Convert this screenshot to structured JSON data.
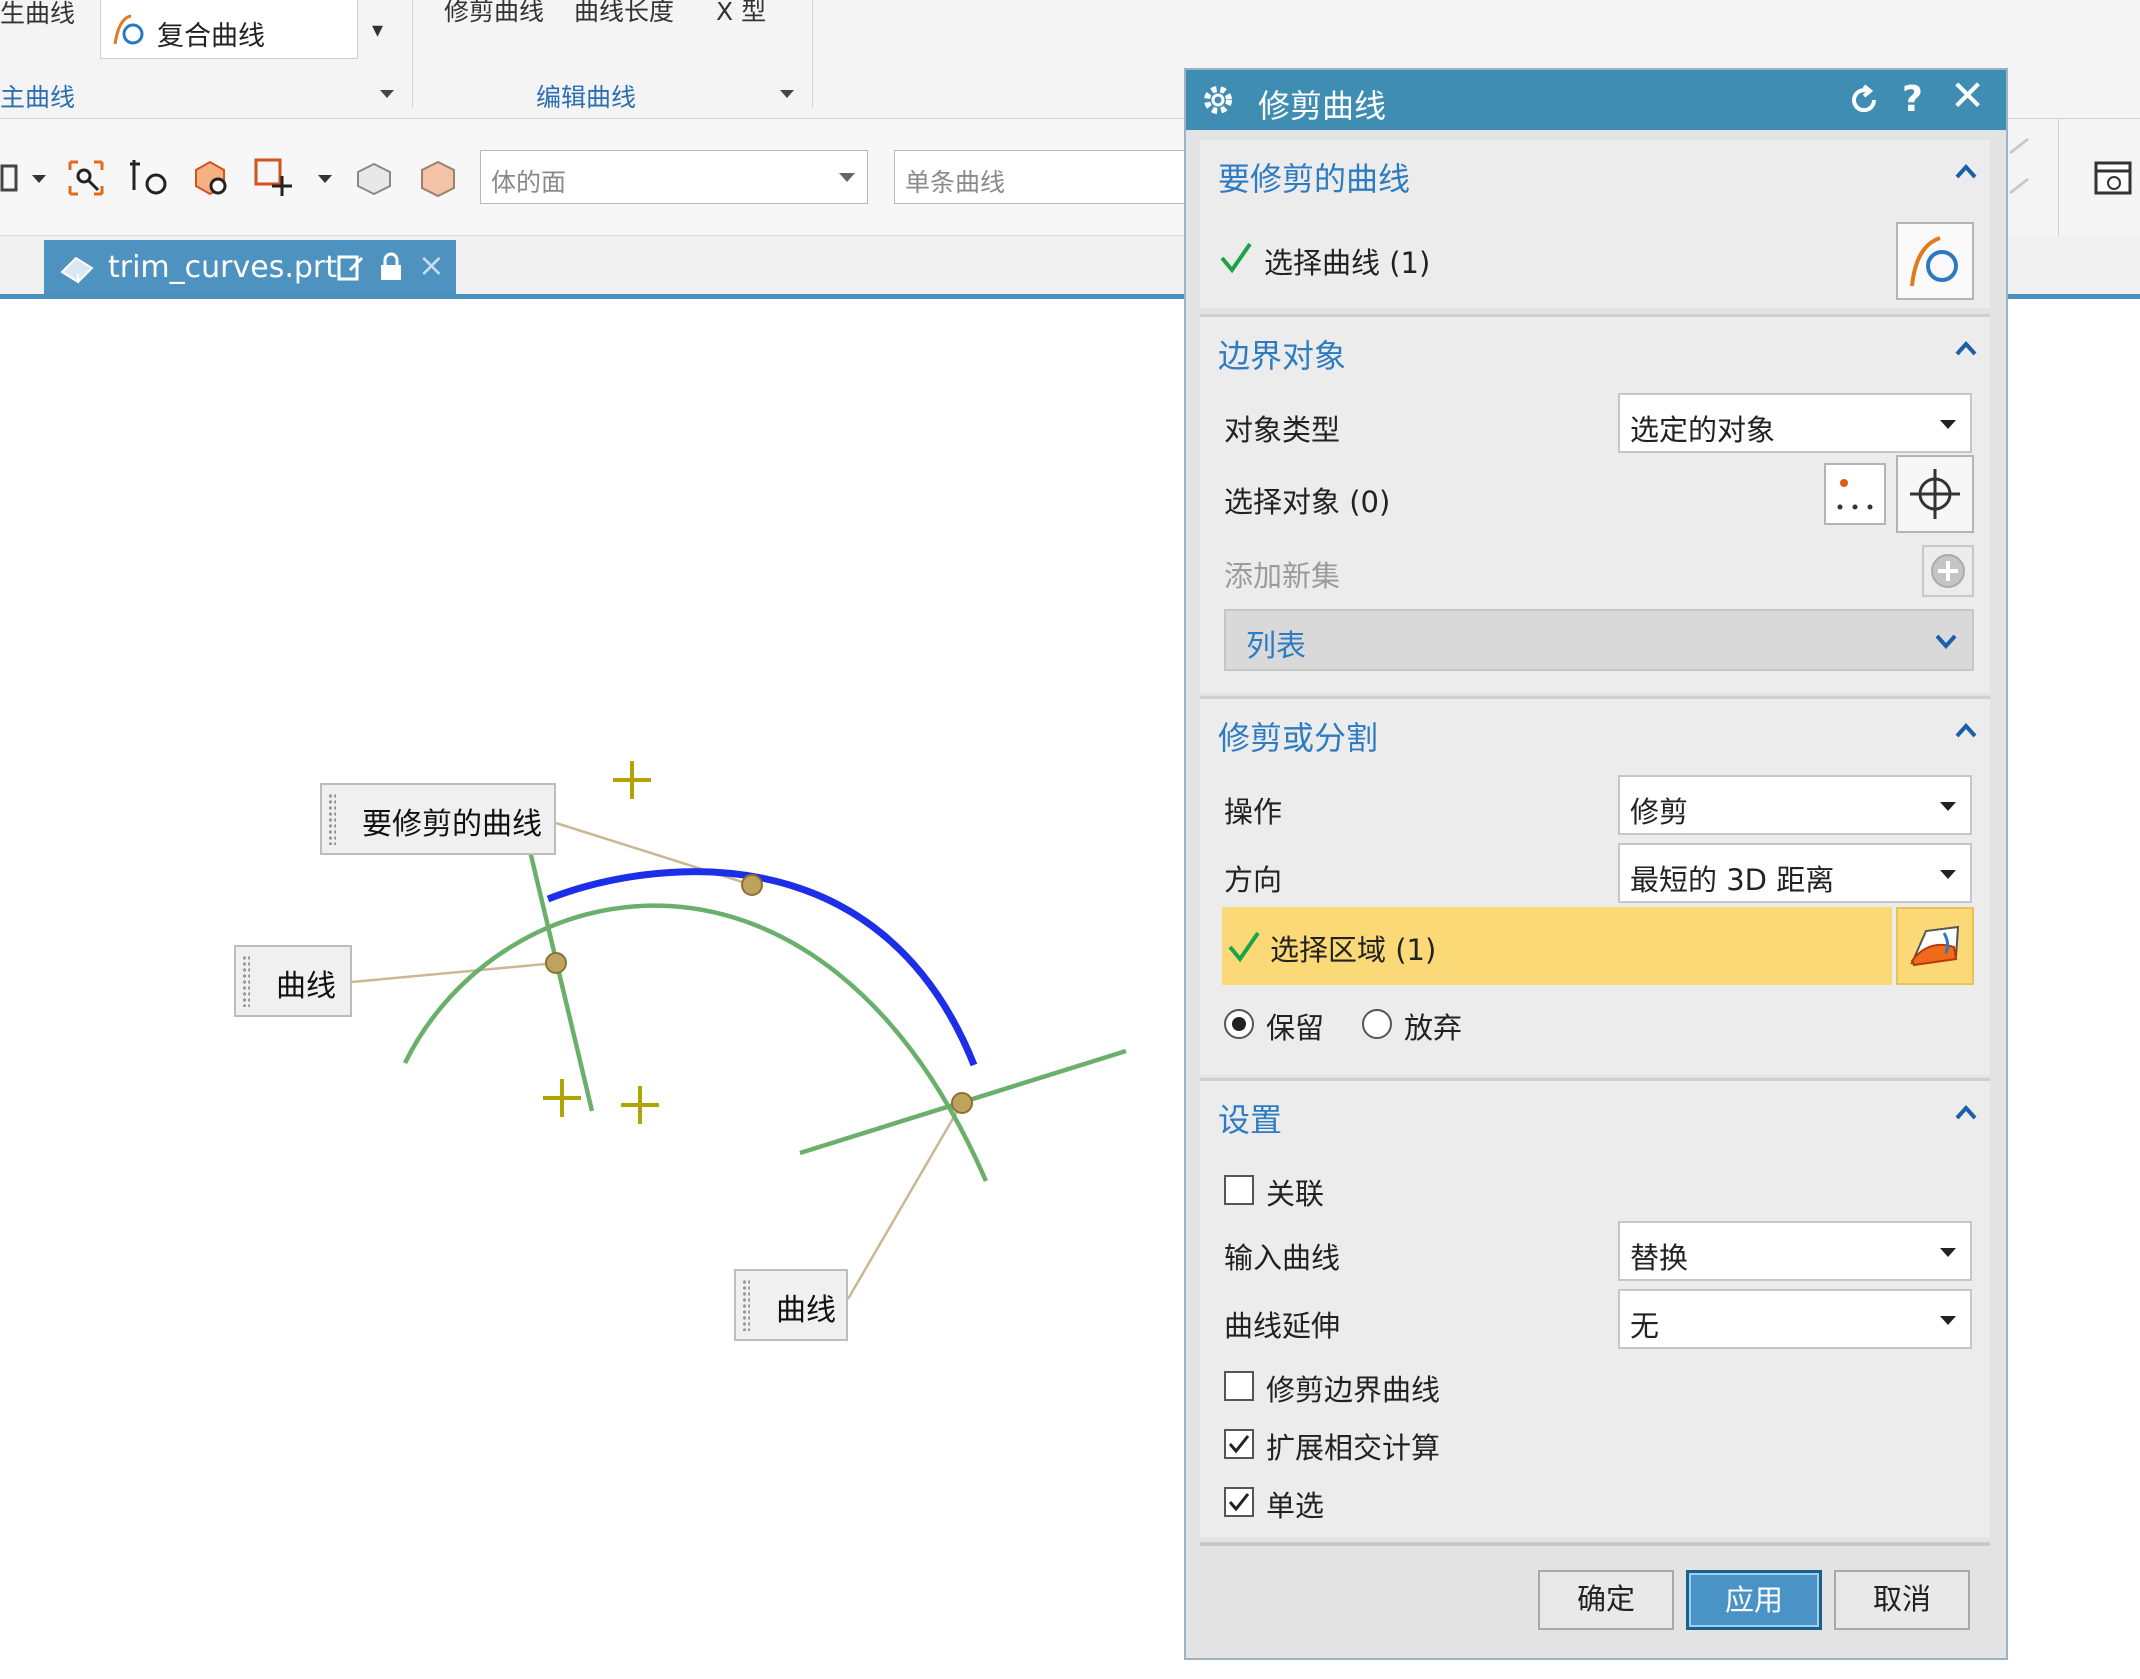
{
  "ribbon": {
    "top_left_partial": "生曲线",
    "composite_curve": "复合曲线",
    "group_left_label": "主曲线",
    "edit_items": [
      "修剪曲线",
      "曲线长度",
      "X 型"
    ],
    "group_edit_label": "编辑曲线"
  },
  "toolbar": {
    "face_filter_placeholder": "体的面",
    "curve_rule_placeholder": "单条曲线"
  },
  "tab": {
    "filename": "trim_curves.prt"
  },
  "canvas": {
    "callout_trim": "要修剪的曲线",
    "callout_curve_1": "曲线",
    "callout_curve_2": "曲线"
  },
  "dialog": {
    "title": "修剪曲线",
    "sec_curve": {
      "title": "要修剪的曲线",
      "select": "选择曲线 (1)"
    },
    "sec_boundary": {
      "title": "边界对象",
      "obj_type_label": "对象类型",
      "obj_type_value": "选定的对象",
      "select_obj": "选择对象 (0)",
      "add_set": "添加新集",
      "list": "列表"
    },
    "sec_trim": {
      "title": "修剪或分割",
      "op_label": "操作",
      "op_value": "修剪",
      "dir_label": "方向",
      "dir_value": "最短的 3D 距离",
      "region": "选择区域 (1)",
      "keep": "保留",
      "discard": "放弃"
    },
    "sec_settings": {
      "title": "设置",
      "associative": "关联",
      "input_curve_label": "输入曲线",
      "input_curve_value": "替换",
      "extension_label": "曲线延伸",
      "extension_value": "无",
      "trim_boundary": "修剪边界曲线",
      "extended_intersect": "扩展相交计算",
      "single_select": "单选"
    },
    "buttons": {
      "ok": "确定",
      "apply": "应用",
      "cancel": "取消"
    }
  }
}
